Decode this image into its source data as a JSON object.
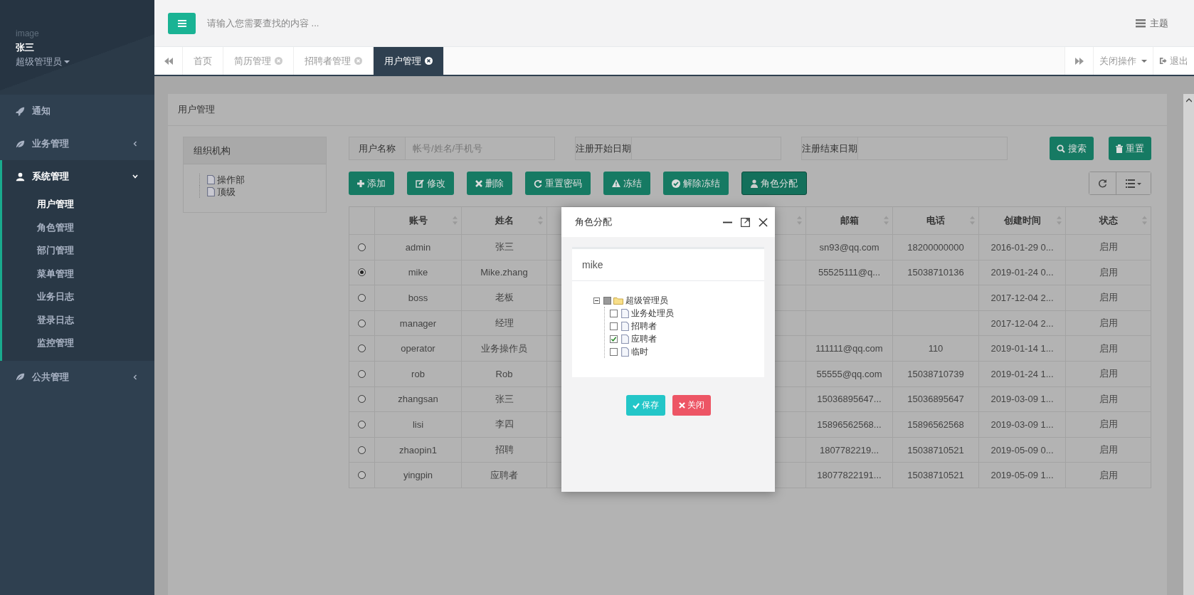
{
  "sidebar": {
    "avatar_text": "image",
    "user_name": "张三",
    "role": "超级管理员",
    "menu": [
      {
        "label": "通知",
        "kind": "link"
      },
      {
        "label": "业务管理",
        "kind": "group",
        "expanded": false
      },
      {
        "label": "系统管理",
        "kind": "group",
        "expanded": true,
        "children": [
          {
            "label": "用户管理",
            "selected": true
          },
          {
            "label": "角色管理",
            "selected": false
          },
          {
            "label": "部门管理",
            "selected": false
          },
          {
            "label": "菜单管理",
            "selected": false
          },
          {
            "label": "业务日志",
            "selected": false
          },
          {
            "label": "登录日志",
            "selected": false
          },
          {
            "label": "监控管理",
            "selected": false
          }
        ]
      },
      {
        "label": "公共管理",
        "kind": "group",
        "expanded": false
      }
    ]
  },
  "topbar": {
    "search": {
      "placeholder": "请输入您需要查找的内容 ..."
    },
    "theme": "主题"
  },
  "tabs": [
    {
      "label": "首页",
      "closable": false,
      "selected": false
    },
    {
      "label": "简历管理",
      "closable": true,
      "selected": false
    },
    {
      "label": "招聘者管理",
      "closable": true,
      "selected": false
    },
    {
      "label": "用户管理",
      "closable": true,
      "selected": true
    }
  ],
  "tab_actions": {
    "close_ops": "关闭操作",
    "logout": "退出"
  },
  "panel": {
    "title": "用户管理",
    "org": {
      "title": "组织机构",
      "tree": [
        {
          "label": "操作部"
        },
        {
          "label": "顶级"
        }
      ]
    },
    "filters": [
      {
        "label": "用户名称",
        "placeholder": "帐号/姓名/手机号"
      },
      {
        "label": "注册开始日期"
      },
      {
        "label": "注册结束日期"
      }
    ],
    "search_buttons": [
      "搜索",
      "重置"
    ],
    "toolbar": [
      "添加",
      "修改",
      "删除",
      "重置密码",
      "冻结",
      "解除冻结",
      "角色分配"
    ],
    "table": {
      "columns": [
        "账号",
        "姓名",
        "邮箱",
        "电话",
        "创建时间",
        "状态"
      ],
      "rows": [
        {
          "selected": false,
          "cells": [
            "admin",
            "张三",
            "sn93@qq.com",
            "18200000000",
            "2016-01-29 0...",
            "启用"
          ]
        },
        {
          "selected": true,
          "cells": [
            "mike",
            "Mike.zhang",
            "55525111@q...",
            "15038710136",
            "2019-01-24 0...",
            "启用"
          ]
        },
        {
          "selected": false,
          "cells": [
            "boss",
            "老板",
            "",
            "",
            "2017-12-04 2...",
            "启用"
          ]
        },
        {
          "selected": false,
          "cells": [
            "manager",
            "经理",
            "",
            "",
            "2017-12-04 2...",
            "启用"
          ]
        },
        {
          "selected": false,
          "cells": [
            "operator",
            "业务操作员",
            "111111@qq.com",
            "110",
            "2019-01-14 1...",
            "启用"
          ]
        },
        {
          "selected": false,
          "cells": [
            "rob",
            "Rob",
            "55555@qq.com",
            "15038710739",
            "2019-01-24 1...",
            "启用"
          ]
        },
        {
          "selected": false,
          "cells": [
            "zhangsan",
            "张三",
            "15036895647...",
            "15036895647",
            "2019-03-09 1...",
            "启用"
          ]
        },
        {
          "selected": false,
          "cells": [
            "lisi",
            "李四",
            "15896562568...",
            "15896562568",
            "2019-03-09 1...",
            "启用"
          ]
        },
        {
          "selected": false,
          "cells": [
            "zhaopin1",
            "招聘",
            "1807782219...",
            "15038710521",
            "2019-05-09 0...",
            "启用"
          ]
        },
        {
          "selected": false,
          "cells": [
            "yingpin",
            "应聘者",
            "18077822191...",
            "15038710521",
            "2019-05-09 1...",
            "启用"
          ]
        }
      ]
    }
  },
  "dialog": {
    "title": "角色分配",
    "user": "mike",
    "tree": {
      "label": "超级管理员",
      "expanded": true,
      "checked": false,
      "partial": true,
      "children": [
        {
          "label": "业务处理员",
          "checked": false
        },
        {
          "label": "招聘者",
          "checked": false
        },
        {
          "label": "应聘者",
          "checked": true
        },
        {
          "label": "临时",
          "checked": false
        }
      ]
    },
    "buttons": [
      "保存",
      "关闭"
    ]
  }
}
